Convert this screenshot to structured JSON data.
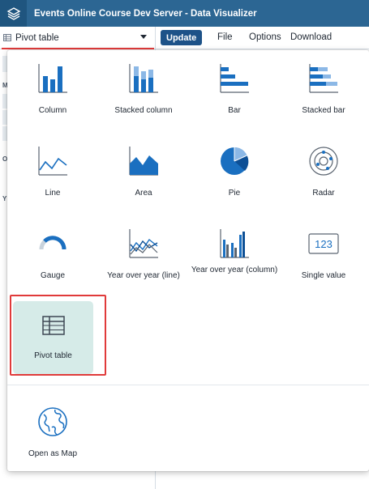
{
  "app": {
    "title": "Events Online Course Dev Server - Data Visualizer"
  },
  "toolbar": {
    "selected_type": "Pivot table",
    "update_label": "Update",
    "menu": [
      "File",
      "Options",
      "Download"
    ]
  },
  "left_panel_letters": [
    "M",
    "O",
    "Y"
  ],
  "vis_types": [
    {
      "label": "Column",
      "icon": "column-chart-icon"
    },
    {
      "label": "Stacked column",
      "icon": "stacked-column-chart-icon"
    },
    {
      "label": "Bar",
      "icon": "bar-chart-icon"
    },
    {
      "label": "Stacked bar",
      "icon": "stacked-bar-chart-icon"
    },
    {
      "label": "Line",
      "icon": "line-chart-icon"
    },
    {
      "label": "Area",
      "icon": "area-chart-icon"
    },
    {
      "label": "Pie",
      "icon": "pie-chart-icon"
    },
    {
      "label": "Radar",
      "icon": "radar-chart-icon"
    },
    {
      "label": "Gauge",
      "icon": "gauge-chart-icon"
    },
    {
      "label": "Year over year (line)",
      "icon": "year-over-year-line-icon"
    },
    {
      "label": "Year over year (column)",
      "icon": "year-over-year-column-icon"
    },
    {
      "label": "Single value",
      "icon": "single-value-icon",
      "icon_text": "123"
    },
    {
      "label": "Pivot table",
      "icon": "pivot-table-icon",
      "selected": true
    }
  ],
  "extra_options": [
    {
      "label": "Open as Map",
      "icon": "globe-icon"
    }
  ],
  "colors": {
    "header": "#2c6693",
    "accent": "#1d5288",
    "chart_blue": "#1a6fc0",
    "chart_light": "#8cb8e6",
    "selected_bg": "#d6ebe8",
    "highlight": "#e03a3a"
  }
}
